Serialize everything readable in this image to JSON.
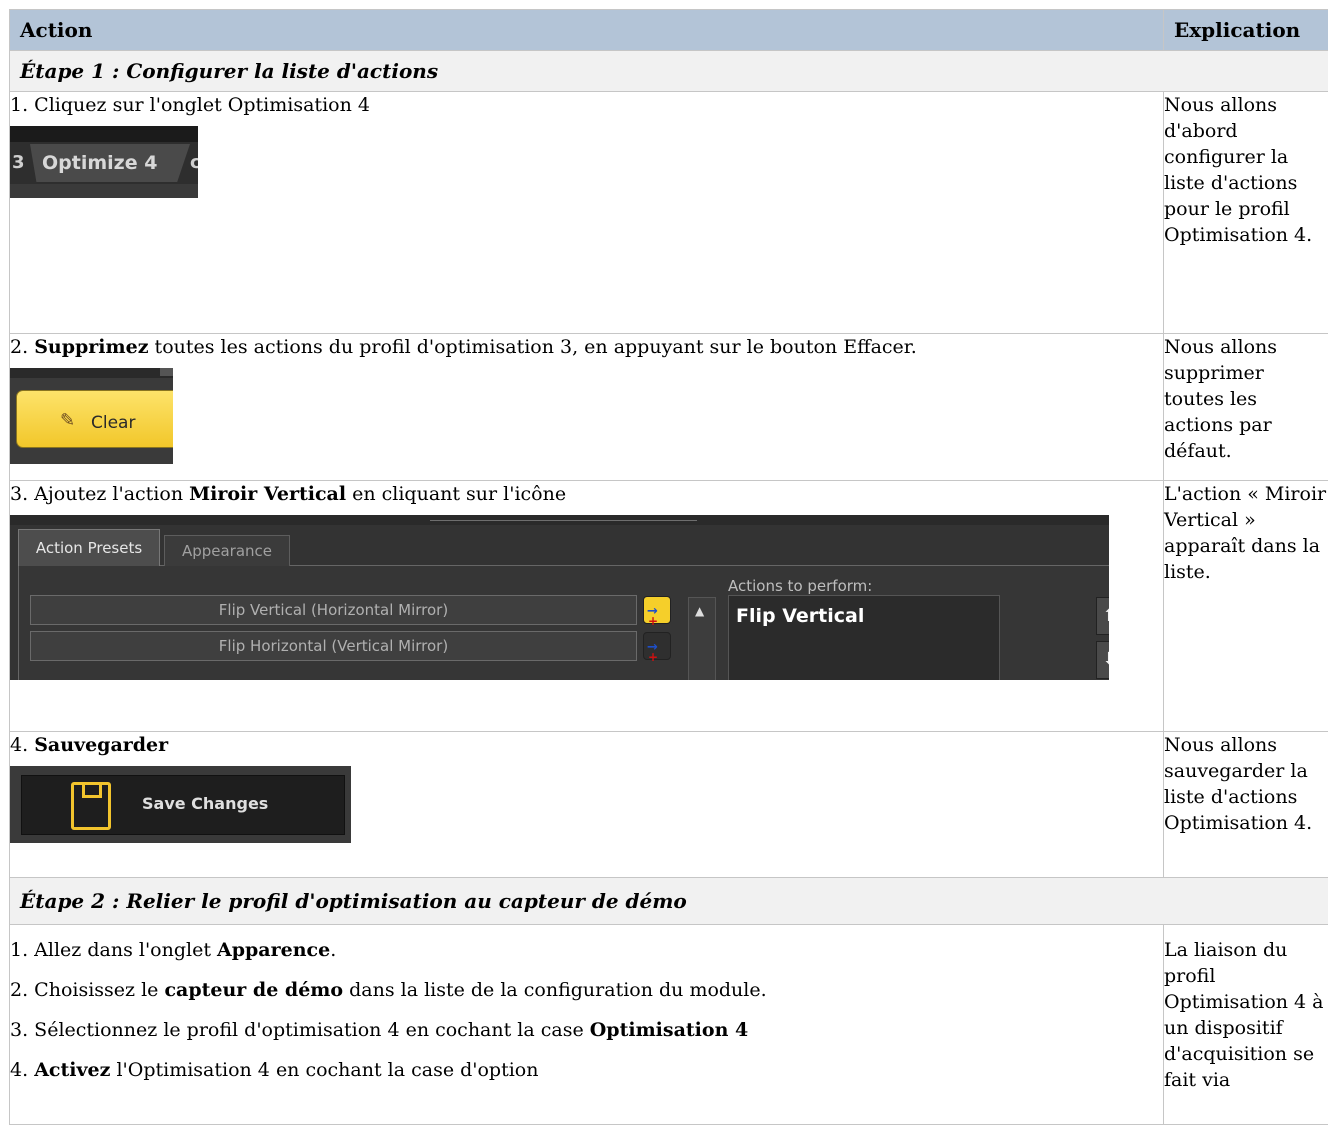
{
  "table": {
    "header": {
      "action": "Action",
      "explication": "Explication"
    },
    "step1": {
      "title": "Étape 1 : Configurer la liste d'actions",
      "rows": [
        {
          "num": "1.",
          "text": " Cliquez sur l'onglet Optimisation 4",
          "explication": "Nous allons d'abord configurer la liste d'actions pour le profil Optimisation 4.",
          "screenshot": {
            "left_num": "3",
            "tab_label": "Optimize 4",
            "right_letter": "c"
          }
        },
        {
          "num": "2.",
          "bold": "Supprimez",
          "text": " toutes les actions du profil d'optimisation 3, en appuyant sur le bouton Effacer.",
          "explication": "Nous allons supprimer toutes les actions par défaut.",
          "screenshot": {
            "button_label": "Clear",
            "icon": "eraser-icon"
          }
        },
        {
          "num": "3.",
          "pre": " Ajoutez l'action ",
          "bold": "Miroir Vertical",
          "text": " en cliquant sur l'icône",
          "explication": "L'action « Miroir Vertical » apparaît dans la liste.",
          "screenshot": {
            "tabs": [
              "Action Presets",
              "Appearance"
            ],
            "actions_label": "Actions to perform:",
            "presets": [
              "Flip Vertical (Horizontal Mirror)",
              "Flip Horizontal (Vertical Mirror)"
            ],
            "perform_items": [
              "Flip Vertical"
            ],
            "up_arrow": "⬆",
            "down_arrow": "⬇",
            "scroll_up": "▲"
          }
        },
        {
          "num": "4.",
          "bold": "Sauvegarder",
          "explication": "Nous allons sauvegarder la liste d'actions Optimisation 4.",
          "screenshot": {
            "button_label": "Save Changes",
            "icon": "floppy-disk-icon"
          }
        }
      ]
    },
    "step2": {
      "title": "Étape 2 : Relier le profil d'optimisation au capteur de démo",
      "lines": [
        {
          "num": "1.",
          "pre": " Allez dans l'onglet ",
          "bold": "Apparence",
          "post": "."
        },
        {
          "num": "2.",
          "pre": " Choisissez le ",
          "bold": "capteur de démo",
          "post": " dans la liste de la configuration du module."
        },
        {
          "num": "3.",
          "pre": " Sélectionnez le profil d'optimisation 4 en cochant la case ",
          "bold": "Optimisation 4",
          "post": ""
        },
        {
          "num": "4.",
          "pre": " ",
          "bold": "Activez",
          "post": " l'Optimisation 4 en cochant la case d'option"
        }
      ],
      "explication": "La liaison du profil Optimisation 4 à un dispositif d'acquisition se fait via"
    },
    "colors": {
      "header_bg": "#b3c4d7",
      "step_bg": "#f1f1f1",
      "border": "#c6c6c6"
    }
  }
}
